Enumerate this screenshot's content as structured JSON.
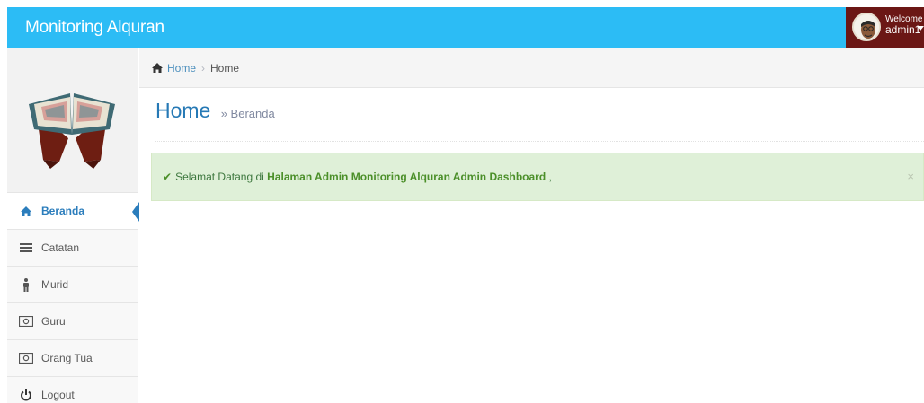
{
  "navbar": {
    "brand": "Monitoring Alquran",
    "welcome": "Welcome",
    "username": "admin1"
  },
  "sidebar": {
    "items": [
      {
        "label": "Beranda",
        "icon": "home-icon",
        "active": true
      },
      {
        "label": "Catatan",
        "icon": "list-icon"
      },
      {
        "label": "Murid",
        "icon": "male-icon"
      },
      {
        "label": "Guru",
        "icon": "money-icon"
      },
      {
        "label": "Orang Tua",
        "icon": "money-icon"
      },
      {
        "label": "Logout",
        "icon": "power-icon"
      }
    ]
  },
  "breadcrumbs": {
    "home_link": "Home",
    "separator": "›",
    "current": "Home"
  },
  "page": {
    "title": "Home",
    "subtitle": "» Beranda"
  },
  "alert": {
    "prefix": "Selamat Datang di",
    "strong": "Halaman Admin Monitoring Alquran Admin Dashboard",
    "suffix": ",",
    "close": "×"
  },
  "colors": {
    "navbar": "#2cbcf5",
    "user_area": "#6b1715",
    "accent": "#2b7dbc",
    "alert_bg": "#dff0d8",
    "alert_text": "#4b8f29"
  }
}
